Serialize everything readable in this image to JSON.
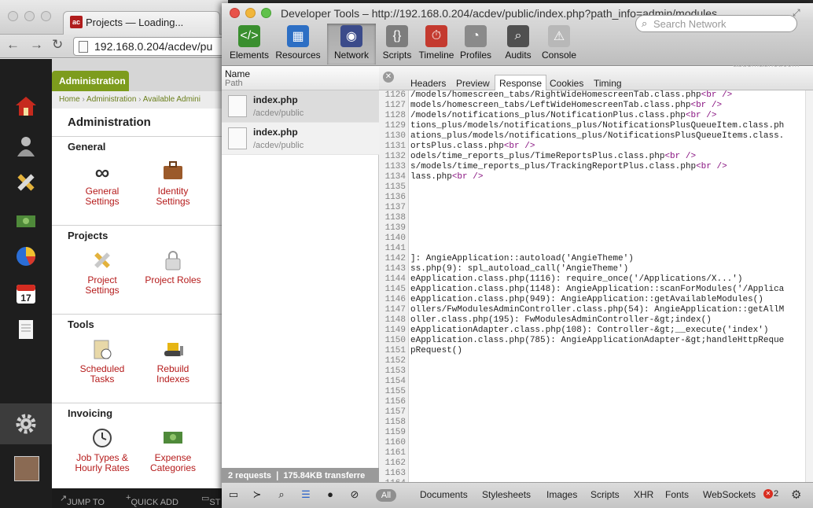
{
  "browser": {
    "tab_title": "Projects — Loading...",
    "tab_favicon_text": "ac",
    "url": "192.168.0.204/acdev/pu",
    "back_icon": "arrow-left-icon",
    "forward_icon": "arrow-right-icon",
    "reload_icon": "reload-icon"
  },
  "app": {
    "sidebar_icons": [
      "home-icon",
      "people-icon",
      "pencil-ruler-icon",
      "money-icon",
      "pie-chart-icon",
      "calendar-icon",
      "document-icon",
      "gear-icon"
    ],
    "calendar_day": "17",
    "admin_tab": "Administration",
    "breadcrumbs": [
      "Home",
      "Administration",
      "Available Admini"
    ],
    "page_title": "Administration",
    "sections": [
      {
        "title": "General",
        "tiles": [
          {
            "label1": "General",
            "label2": "Settings",
            "icon": "infinity-logo-icon"
          },
          {
            "label1": "Identity",
            "label2": "Settings",
            "icon": "briefcase-icon"
          }
        ]
      },
      {
        "title": "Projects",
        "tiles": [
          {
            "label1": "Project",
            "label2": "Settings",
            "icon": "pencil-ruler-icon"
          },
          {
            "label1": "Project Roles",
            "label2": "",
            "icon": "lock-icon"
          }
        ]
      },
      {
        "title": "Tools",
        "tiles": [
          {
            "label1": "Scheduled",
            "label2": "Tasks",
            "icon": "clipboard-clock-icon"
          },
          {
            "label1": "Rebuild",
            "label2": "Indexes",
            "icon": "bulldozer-icon"
          }
        ]
      },
      {
        "title": "Invoicing",
        "tiles": [
          {
            "label1": "Job Types &",
            "label2": "Hourly Rates",
            "icon": "clock-icon"
          },
          {
            "label1": "Expense",
            "label2": "Categories",
            "icon": "money-icon"
          }
        ]
      }
    ],
    "bottom": {
      "jump": "JUMP TO",
      "quick": "QUICK ADD",
      "more": "ST"
    }
  },
  "devtools": {
    "title": "Developer Tools – http://192.168.0.204/acdev/public/index.php?path_info=admin/modules",
    "toolbar": [
      {
        "label": "Elements",
        "icon": "elements-icon"
      },
      {
        "label": "Resources",
        "icon": "resources-icon"
      },
      {
        "label": "Network",
        "icon": "network-icon"
      },
      {
        "label": "Scripts",
        "icon": "scripts-icon"
      },
      {
        "label": "Timeline",
        "icon": "timeline-icon"
      },
      {
        "label": "Profiles",
        "icon": "profiles-icon"
      },
      {
        "label": "Audits",
        "icon": "audits-icon"
      },
      {
        "label": "Console",
        "icon": "console-icon"
      }
    ],
    "search_placeholder": "Search Network",
    "watermark": "appsmagnet.com",
    "list_header": {
      "name": "Name",
      "path": "Path"
    },
    "requests": [
      {
        "name": "index.php",
        "path": "/acdev/public"
      },
      {
        "name": "index.php",
        "path": "/acdev/public"
      }
    ],
    "status": "2 requests  ❘  175.84KB transferre",
    "tabs": [
      "Headers",
      "Preview",
      "Response",
      "Cookies",
      "Timing"
    ],
    "line_numbers": [
      "1126",
      "1127",
      "1128",
      "1129",
      "1130",
      "1131",
      "1132",
      "1133",
      "1134",
      "1135",
      "1136",
      "1137",
      "1138",
      "1139",
      "1140",
      "1141",
      "1142",
      "1143",
      "1144",
      "1145",
      "1146",
      "1147",
      "1148",
      "1149",
      "1150",
      "1151",
      "1152",
      "1153",
      "1154",
      "1155",
      "1156",
      "1157",
      "1158",
      "1159",
      "1160",
      "1161",
      "1162",
      "1163",
      "1164"
    ],
    "code_lines": [
      "/models/homescreen_tabs/RightWideHomescreenTab.class.php<br />",
      "models/homescreen_tabs/LeftWideHomescreenTab.class.php<br />",
      "/models/notifications_plus/NotificationPlus.class.php<br />",
      "tions_plus/models/notifications_plus/NotificationsPlusQueueItem.class.ph",
      "ations_plus/models/notifications_plus/NotificationsPlusQueueItems.class.",
      "ortsPlus.class.php<br />",
      "odels/time_reports_plus/TimeReportsPlus.class.php<br />",
      "s/models/time_reports_plus/TrackingReportPlus.class.php<br />",
      "lass.php<br />",
      "",
      "",
      "",
      "",
      "",
      "",
      "",
      "]: AngieApplication::autoload('AngieTheme')",
      "ss.php(9): spl_autoload_call('AngieTheme')",
      "eApplication.class.php(1116): require_once('/Applications/X...')",
      "eApplication.class.php(1148): AngieApplication::scanForModules('/Applica",
      "eApplication.class.php(949): AngieApplication::getAvailableModules()",
      "ollers/FwModulesAdminController.class.php(54): AngieApplication::getAllM",
      "oller.class.php(195): FwModulesAdminController-&gt;index()",
      "eApplicationAdapter.class.php(108): Controller-&gt;__execute('index')",
      "eApplication.class.php(785): AngieApplicationAdapter-&gt;handleHttpReque",
      "pRequest()",
      "",
      "",
      "",
      "",
      "",
      "",
      "",
      "",
      "",
      "",
      "",
      "",
      ""
    ],
    "filters": [
      "All",
      "Documents",
      "Stylesheets",
      "Images",
      "Scripts",
      "XHR",
      "Fonts",
      "WebSockets"
    ],
    "error_count": "2",
    "bottom_icons": [
      "dock-icon",
      "console-toggle-icon",
      "search-icon",
      "list-icon",
      "record-icon",
      "clear-icon"
    ]
  }
}
